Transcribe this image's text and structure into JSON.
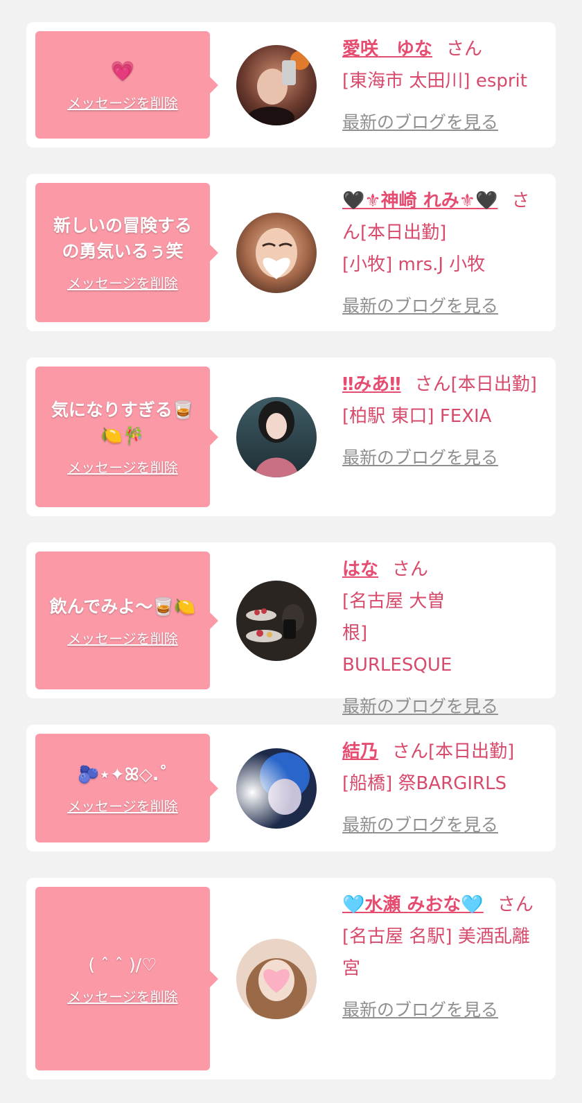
{
  "delete_label": "メッセージを削除",
  "blog_label": "最新のブログを見る",
  "honorific": "さん",
  "colors": {
    "bubble": "#fb99a7",
    "name": "#e64c70",
    "shop": "#d74a6b",
    "link_gray": "#8f8f8f",
    "background": "#f2f2f2"
  },
  "items": [
    {
      "message": "💗",
      "name": "愛咲　ゆな",
      "status": "",
      "shop": "[東海市 太田川] esprit"
    },
    {
      "message": "新しいの冒険するの勇気いるぅ笑",
      "name": "🖤⚜神崎 れみ⚜🖤",
      "status": "[本日出勤]",
      "shop": "[小牧] mrs.J 小牧"
    },
    {
      "message": "気になりすぎる🥃🍋🎋",
      "name": "‼みあ‼",
      "status": "[本日出勤]",
      "shop": "[柏駅 東口] FEXIA"
    },
    {
      "message": "飲んでみよ～🥃🍋",
      "name": "はな",
      "status": "",
      "shop": "[名古屋 大曽根] BURLESQUE"
    },
    {
      "message": "🫐⋆✦ꕤ◇.˚",
      "name": "結乃",
      "status": "[本日出勤]",
      "shop": "[船橋] 祭BARGIRLS"
    },
    {
      "message": "( ˆ ˆ )/♡",
      "name": "🩵水瀬 みおな🩵",
      "status": "",
      "shop": "[名古屋 名駅] 美酒乱離宮"
    }
  ]
}
